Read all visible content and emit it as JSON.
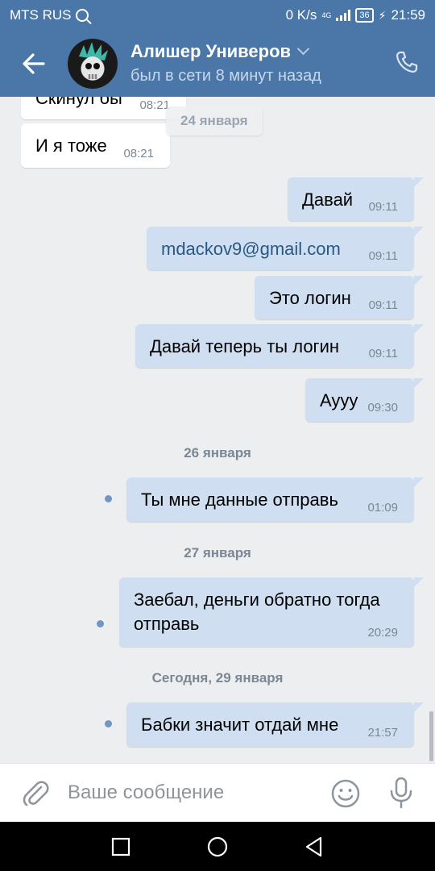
{
  "status_bar": {
    "carrier": "MTS RUS",
    "net_speed": "0 K/s",
    "network_type": "4G",
    "battery": "36",
    "time": "21:59"
  },
  "header": {
    "name": "Алишер Универов",
    "status": "был в сети 8 минут назад"
  },
  "messages": [
    {
      "dir": "in",
      "text": "Скинул бы",
      "time": "08:21"
    },
    {
      "dir": "date-floating",
      "text": "24 января"
    },
    {
      "dir": "in",
      "text": "И я тоже",
      "time": "08:21"
    },
    {
      "dir": "out",
      "text": "Давай",
      "time": "09:11"
    },
    {
      "dir": "out",
      "text": "mdackov9@gmail.com",
      "time": "09:11",
      "link": true
    },
    {
      "dir": "out",
      "text": "Это логин",
      "time": "09:11"
    },
    {
      "dir": "out",
      "text": "Давай теперь ты логин",
      "time": "09:11"
    },
    {
      "dir": "out",
      "text": "Аууу",
      "time": "09:30"
    },
    {
      "dir": "date",
      "text": "26 января"
    },
    {
      "dir": "out",
      "text": "Ты мне данные отправь",
      "time": "01:09",
      "unread": true
    },
    {
      "dir": "date",
      "text": "27 января"
    },
    {
      "dir": "out",
      "text": "Заебал, деньги обратно тогда\nотправь",
      "time": "20:29",
      "unread": true
    },
    {
      "dir": "date",
      "text": "Сегодня, 29 января"
    },
    {
      "dir": "out",
      "text": "Бабки значит отдай мне",
      "time": "21:57",
      "unread": true
    }
  ],
  "composer": {
    "placeholder": "Ваше сообщение"
  },
  "colors": {
    "header_bg": "#4a76a8",
    "chat_bg": "#edeef0",
    "outgoing_bubble": "#cfdef0",
    "incoming_bubble": "#ffffff",
    "link": "#2a5885",
    "unread_dot": "#6f96c4"
  },
  "icons": {
    "back": "arrow-left-icon",
    "phone": "phone-icon",
    "attach": "paperclip-icon",
    "emoji": "smiley-icon",
    "mic": "microphone-icon",
    "nav_recent": "square-icon",
    "nav_home": "circle-icon",
    "nav_back": "triangle-icon"
  }
}
